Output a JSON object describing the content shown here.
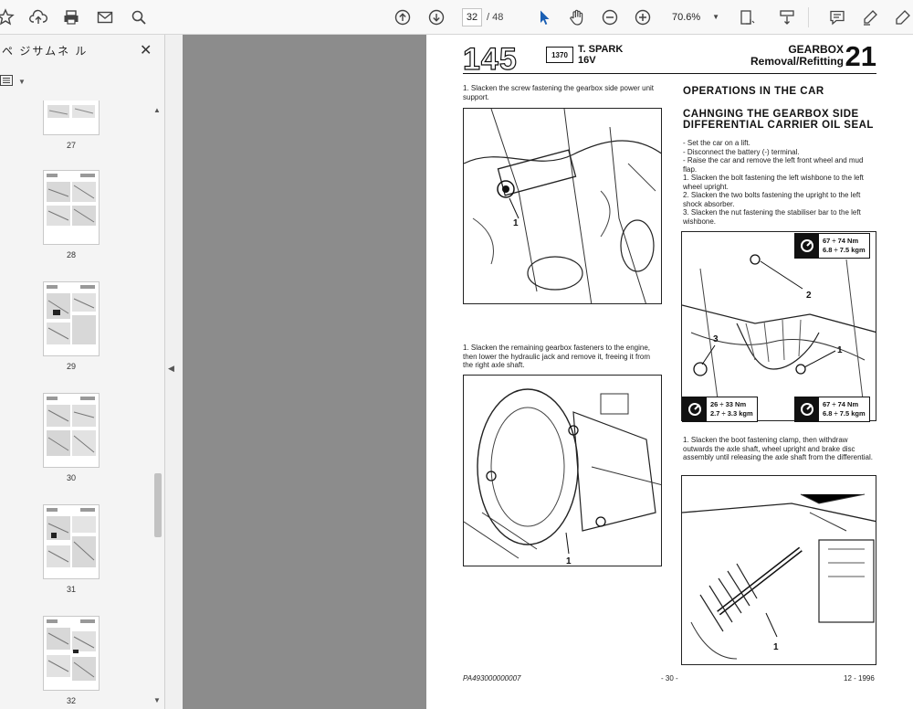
{
  "toolbar": {
    "current_page": "32",
    "total_pages": "/ 48",
    "zoom": "70.6%"
  },
  "sidebar": {
    "title": "ペ ジサムネ ル",
    "thumbnails": [
      {
        "label": "27"
      },
      {
        "label": "28"
      },
      {
        "label": "29"
      },
      {
        "label": "30"
      },
      {
        "label": "31"
      },
      {
        "label": "32"
      }
    ]
  },
  "page": {
    "model_number": "145",
    "engine_badge": "1370",
    "engine_line1": "T. SPARK",
    "engine_line2": "16V",
    "section_line1": "GEARBOX",
    "section_line2": "Removal/Refitting",
    "chapter": "21",
    "left_step1": "1. Slacken the screw fastening the gearbox side power unit support.",
    "left_step2": "1. Slacken the remaining gearbox fasteners to the engine, then lower the hydraulic jack and remove it, freeing it from the right axle shaft.",
    "heading_ops": "OPERATIONS IN THE CAR",
    "heading_seal_line1": "CAHNGING THE GEARBOX SIDE",
    "heading_seal_line2": "DIFFERENTIAL CARRIER OIL SEAL",
    "right_steps": "- Set the car on a lift.\n- Disconnect the battery (-) terminal.\n- Raise the car and remove the left front wheel and mud flap.\n1. Slacken the bolt fastening the left wishbone to the left wheel upright.\n2. Slacken the two bolts fastening the upright to the left shock absorber.\n3. Slacken the nut fastening the stabiliser bar to the left wishbone.",
    "right_step_clamp": "1. Slacken the boot fastening clamp, then withdraw outwards the axle shaft, wheel upright and brake disc assembly until releasing the axle shaft from the differential.",
    "torque_top_right": {
      "line1": "67 ÷ 74 Nm",
      "line2": "6.8 ÷ 7.5 kgm"
    },
    "torque_bottom_left": {
      "line1": "26 ÷ 33 Nm",
      "line2": "2.7 ÷ 3.3 kgm"
    },
    "torque_bottom_right": {
      "line1": "67 ÷ 74 Nm",
      "line2": "6.8 ÷ 7.5 kgm"
    },
    "footer_code": "PA493000000007",
    "footer_page": "- 30 -",
    "footer_date": "12 - 1996"
  }
}
